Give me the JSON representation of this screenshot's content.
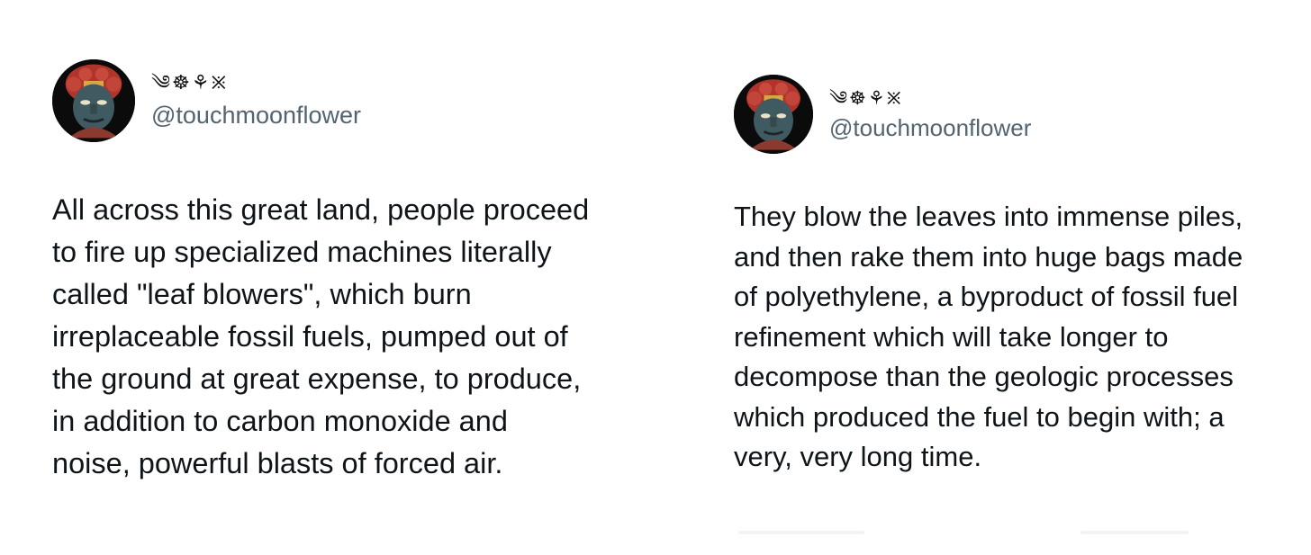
{
  "tweets": [
    {
      "avatar_icon": "wrathful-deity-statue-avatar",
      "display_name": "༄☸⚘྿",
      "handle": "@touchmoonflower",
      "text": "All across this great land, people proceed\nto fire up specialized machines literally\ncalled \"leaf blowers\", which burn\nirreplaceable fossil fuels, pumped out of\nthe ground at great expense, to produce,\nin addition to carbon monoxide and\nnoise, powerful blasts of forced air."
    },
    {
      "avatar_icon": "wrathful-deity-statue-avatar",
      "display_name": "༄☸⚘྿",
      "handle": "@touchmoonflower",
      "text": "They blow the leaves into immense piles,\nand then rake them into huge bags made\nof polyethylene, a byproduct of fossil fuel\nrefinement which will take longer to\ndecompose than the geologic processes\nwhich produced the fuel to begin with; a\nvery, very long time."
    }
  ],
  "colors": {
    "text": "#0f1419",
    "handle": "#536471",
    "background": "#ffffff"
  }
}
